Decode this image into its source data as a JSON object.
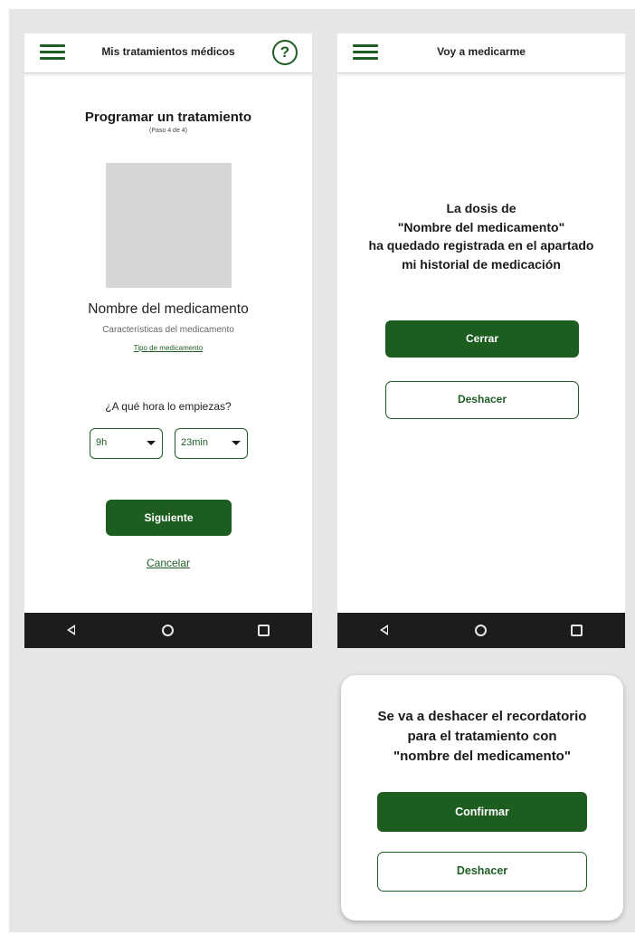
{
  "screen_schedule": {
    "appbar": {
      "title": "Mis tratamientos médicos",
      "help_glyph": "?"
    },
    "title": "Programar un tratamiento",
    "step": "(Paso 4 de 4)",
    "medication_name": "Nombre del medicamento",
    "medication_characteristics": "Características del medicamento",
    "medication_type_link": "Tipo de medicamento",
    "question": "¿A qué hora lo empiezas?",
    "hour_select": {
      "value": "9h"
    },
    "minute_select": {
      "value": "23min"
    },
    "next_button": "Siguiente",
    "cancel_link": "Cancelar"
  },
  "screen_confirmation": {
    "appbar": {
      "title": "Voy a medicarme"
    },
    "message_lines": [
      "La dosis de",
      "\"Nombre del medicamento\"",
      "ha quedado registrada en el apartado",
      "mi historial de medicación"
    ],
    "close_button": "Cerrar",
    "undo_button": "Deshacer"
  },
  "undo_dialog": {
    "message_lines": [
      "Se va a deshacer el recordatorio",
      "para el tratamiento con",
      "\"nombre del medicamento\""
    ],
    "confirm_button": "Confirmar",
    "undo_button": "Deshacer"
  },
  "icons": {
    "menu": "hamburger-menu-icon",
    "help": "help-circle-icon",
    "dropdown": "chevron-down-icon",
    "nav_back": "nav-back-icon",
    "nav_home": "nav-home-icon",
    "nav_recent": "nav-recent-apps-icon"
  },
  "colors": {
    "primary_green": "#1d5e20",
    "image_placeholder": "#d6d6d6",
    "nav_bar": "#1c1c1c",
    "canvas": "#e6e6e6"
  }
}
